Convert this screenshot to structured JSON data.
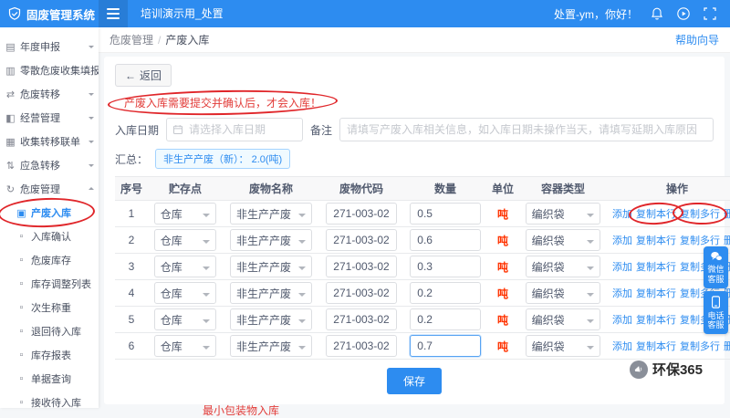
{
  "topbar": {
    "brand": "固废管理系统",
    "workspace_tab": "培训演示用_处置",
    "greeting": "处置-ym，你好！"
  },
  "breadcrumb": {
    "parent": "危废管理",
    "separator": "/",
    "current": "产废入库",
    "help_link": "帮助向导"
  },
  "sidebar": {
    "items": [
      {
        "label": "年度申报"
      },
      {
        "label": "零散危废收集填报"
      },
      {
        "label": "危废转移"
      },
      {
        "label": "经营管理"
      },
      {
        "label": "收集转移联单"
      },
      {
        "label": "应急转移"
      },
      {
        "label": "危废管理"
      },
      {
        "label": "产废入库"
      },
      {
        "label": "入库确认"
      },
      {
        "label": "危废库存"
      },
      {
        "label": "库存调整列表"
      },
      {
        "label": "次生称重"
      },
      {
        "label": "退回待入库"
      },
      {
        "label": "库存报表"
      },
      {
        "label": "单据查询"
      },
      {
        "label": "接收待入库"
      }
    ]
  },
  "content": {
    "back_button": "返回",
    "warning": "产废入库需要提交并确认后，才会入库！",
    "form": {
      "date_label": "入库日期",
      "date_placeholder": "请选择入库日期",
      "note_label": "备注",
      "note_placeholder": "请填写产废入库相关信息，如入库日期未操作当天，请填写延期入库原因"
    },
    "summary_label": "汇总：",
    "summary_badge": "非生产产废（新）： 2.0(吨)",
    "table": {
      "headers": [
        "序号",
        "贮存点",
        "废物名称",
        "废物代码",
        "数量",
        "单位",
        "容器类型",
        "操作"
      ],
      "ops": [
        "添加",
        "复制本行",
        "复制多行",
        "删除"
      ],
      "rows": [
        {
          "seq": "1",
          "storage": "仓库",
          "waste_name": "非生产产废",
          "code": "271-003-02",
          "qty": "0.5",
          "unit": "吨",
          "container": "编织袋"
        },
        {
          "seq": "2",
          "storage": "仓库",
          "waste_name": "非生产产废",
          "code": "271-003-02",
          "qty": "0.6",
          "unit": "吨",
          "container": "编织袋"
        },
        {
          "seq": "3",
          "storage": "仓库",
          "waste_name": "非生产产废",
          "code": "271-003-02",
          "qty": "0.3",
          "unit": "吨",
          "container": "编织袋"
        },
        {
          "seq": "4",
          "storage": "仓库",
          "waste_name": "非生产产废",
          "code": "271-003-02",
          "qty": "0.2",
          "unit": "吨",
          "container": "编织袋"
        },
        {
          "seq": "5",
          "storage": "仓库",
          "waste_name": "非生产产废",
          "code": "271-003-02",
          "qty": "0.2",
          "unit": "吨",
          "container": "编织袋"
        },
        {
          "seq": "6",
          "storage": "仓库",
          "waste_name": "非生产产废",
          "code": "271-003-02",
          "qty": "0.7",
          "unit": "吨",
          "container": "编织袋"
        }
      ]
    },
    "save_button": "保存",
    "footnote": "最小包装物入库"
  },
  "floating": {
    "wechat": "微信客服",
    "phone": "电话客服"
  },
  "watermark": "环保365",
  "colors": {
    "primary": "#2d8cf0",
    "danger": "#e23c39",
    "unit_red": "#ff3300",
    "annotation_red": "#e0262a"
  }
}
